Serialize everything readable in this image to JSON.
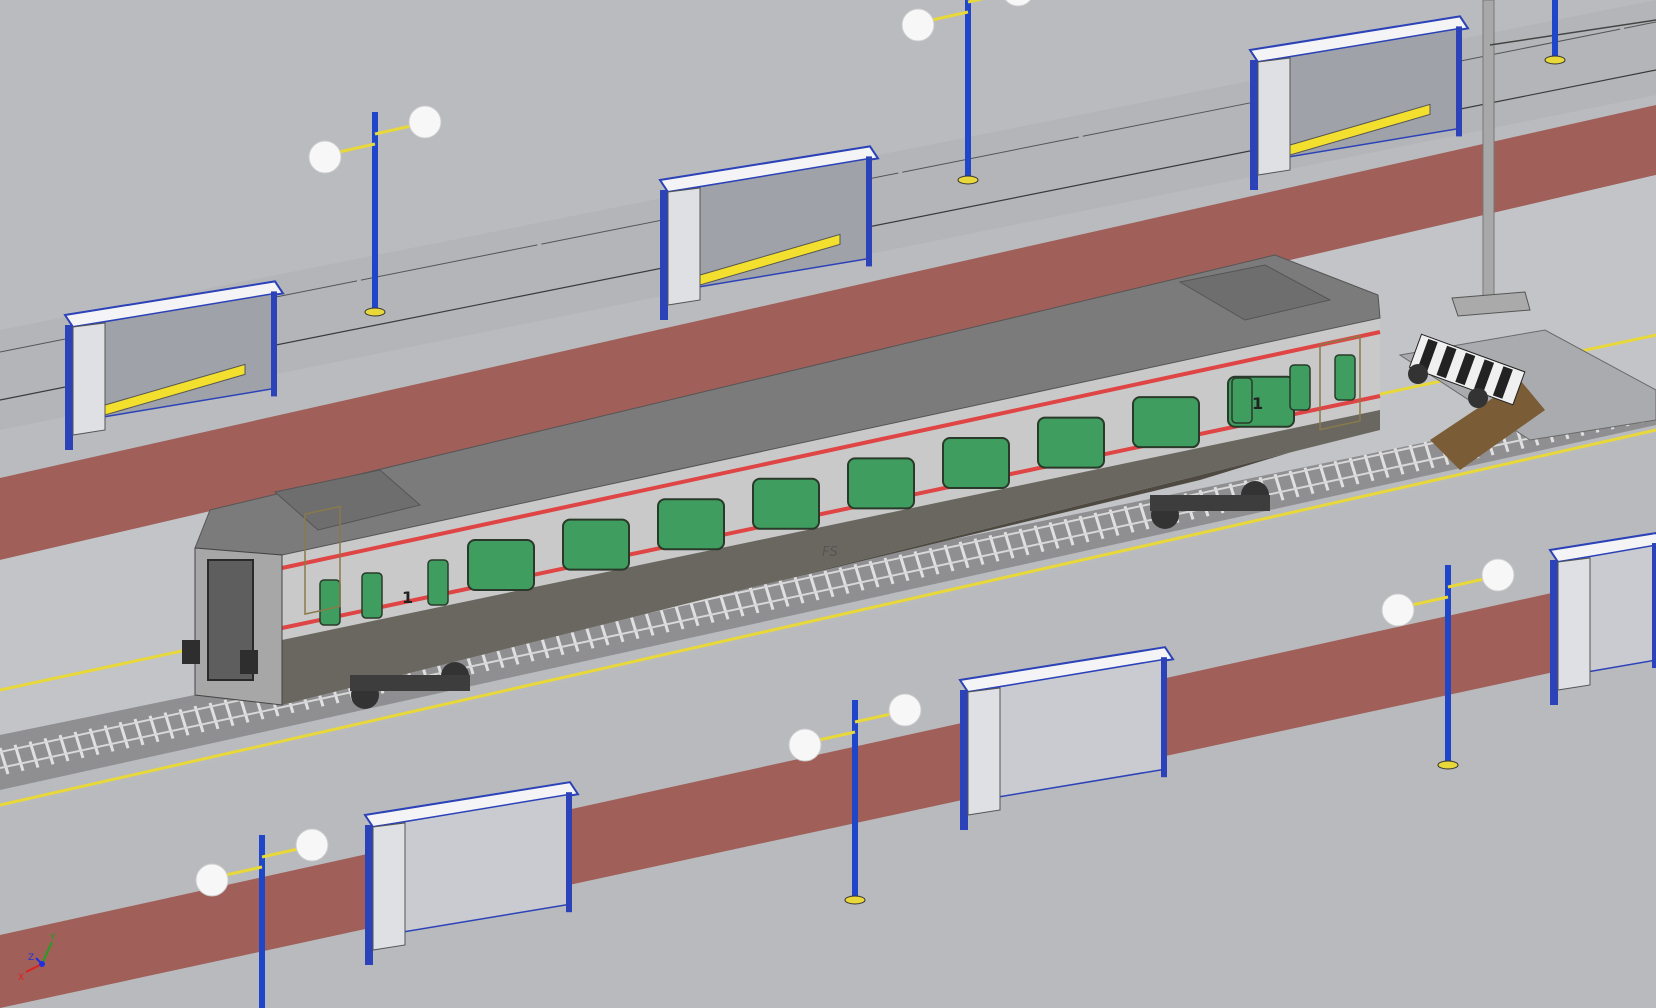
{
  "viewport": {
    "background": "#b9bbbf",
    "colors": {
      "platform": "#b8babd",
      "platform_light": "#c6c8cb",
      "red_strip": "#a05f58",
      "track_bed": "#9a9a9a",
      "pole_blue": "#1f45c8",
      "lamp_globe": "#f7f7f7",
      "bench_yellow": "#f2df2e",
      "shelter_panel": "#dfe0e4",
      "shelter_frame": "#2b42b8",
      "car_roof": "#7d7d7d",
      "car_body": "#c8c8c8",
      "car_lower": "#5f5f5f",
      "red_stripe": "#e04545",
      "window_green": "#3f9e5f",
      "buffer_stop_wood": "#7a5c36"
    }
  },
  "railcar": {
    "markings": {
      "operator": "FS",
      "first_class_left": "1",
      "first_class_right": "1"
    }
  },
  "scene_objects": {
    "shelters": [
      "shelter",
      "shelter",
      "shelter",
      "shelter",
      "shelter",
      "shelter"
    ],
    "lamp_posts": [
      "lamp",
      "lamp",
      "lamp",
      "lamp",
      "lamp",
      "lamp"
    ],
    "buffer_stop": "buffer-stop",
    "catenary_mast": "mast"
  },
  "axis_triad": {
    "x_label": "X",
    "y_label": "Y",
    "z_label": "Z",
    "x_color": "#e02020",
    "y_color": "#20a020",
    "z_color": "#2030e0"
  }
}
